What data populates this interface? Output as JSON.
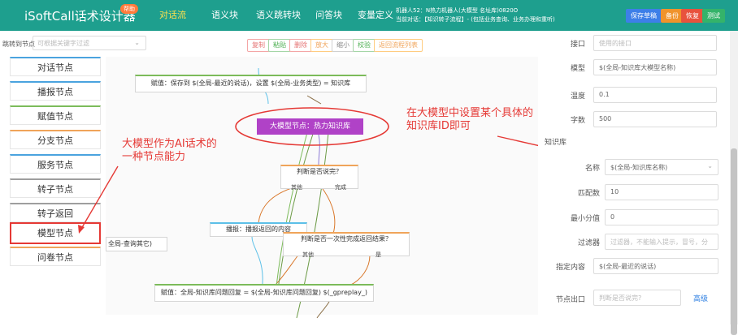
{
  "app": {
    "title": "iSoftCall话术设计器",
    "help_badge": "帮助"
  },
  "nav": {
    "items": [
      {
        "label": "对话流",
        "active": true
      },
      {
        "label": "语义块",
        "active": false
      },
      {
        "label": "语义跳转块",
        "active": false
      },
      {
        "label": "问答块",
        "active": false
      },
      {
        "label": "变量定义",
        "active": false
      }
    ]
  },
  "robot": {
    "line1": "机器人52：N热力机器人(大模型 名址库)0820O",
    "line2": "当前对话：【知识转子流程】- (包括业务查询、业务办理和重听)"
  },
  "top_buttons": {
    "save_publish": "保存草稿",
    "backup": "备份",
    "restore": "恢复",
    "test": "测试"
  },
  "left": {
    "jump_label": "跳转到节点",
    "jump_placeholder": "可根据关键字过滤",
    "nodes": [
      "对话节点",
      "播报节点",
      "赋值节点",
      "分支节点",
      "服务节点",
      "转子节点",
      "转子返回",
      "模型节点",
      "问卷节点"
    ]
  },
  "toolbar": {
    "copy": "复制",
    "paste": "粘贴",
    "delete": "删除",
    "zoom_in": "放大",
    "zoom_out": "缩小",
    "validate": "校验",
    "back_to_list": "返回流程列表"
  },
  "flow": {
    "assign_top": "赋值：保存到 $(全局-最近的说话)，设置 $(全局-业务类型) = 知识库",
    "model_node": "大模型节点：热力知识库",
    "judge_node": "判断是否说完？",
    "judge_yes1": "其他",
    "judge_no1": "完成",
    "broadcast": "播报：播报返回的内容",
    "judge2": "判断是否一次性完成返回结果？",
    "judge2_a": "其他",
    "judge2_b": "是",
    "global_query": "全局-查询其它)",
    "assign_bottom": "赋值：全局-知识库问题回复 = $(全局-知识库问题回复) $(_gpreplay_)"
  },
  "right": {
    "interface_label": "接口",
    "interface_placeholder": "使用的接口",
    "model_label": "模型",
    "model_value": "$(全局-知识库大模型名称)",
    "temperature_label": "温度",
    "temperature_value": "0.1",
    "tokens_label": "字数",
    "tokens_value": "500",
    "kb_section": "知识库",
    "name_label": "名称",
    "name_value": "$(全局-知识库名称)",
    "match_label": "匹配数",
    "match_value": "10",
    "min_score_label": "最小分值",
    "min_score_value": "0",
    "filter_label": "过滤器",
    "filter_placeholder": "过滤器，不能输入提示，冒号，分",
    "content_label": "指定内容",
    "content_value": "$(全局-最近的说话)",
    "exit_label": "节点出口",
    "exit_placeholder": "判断是否说完?",
    "advanced_link": "高级"
  },
  "annotations": {
    "left_text_line1": "大模型作为AI话术的",
    "left_text_line2": "一种节点能力",
    "right_text_line1": "在大模型中设置某个具体的",
    "right_text_line2": "知识库ID即可"
  },
  "colors": {
    "topbar": "#1e9f8e",
    "nav_active": "#ffe14d",
    "accent_red": "#e53935",
    "model_purple": "#b042c7"
  }
}
